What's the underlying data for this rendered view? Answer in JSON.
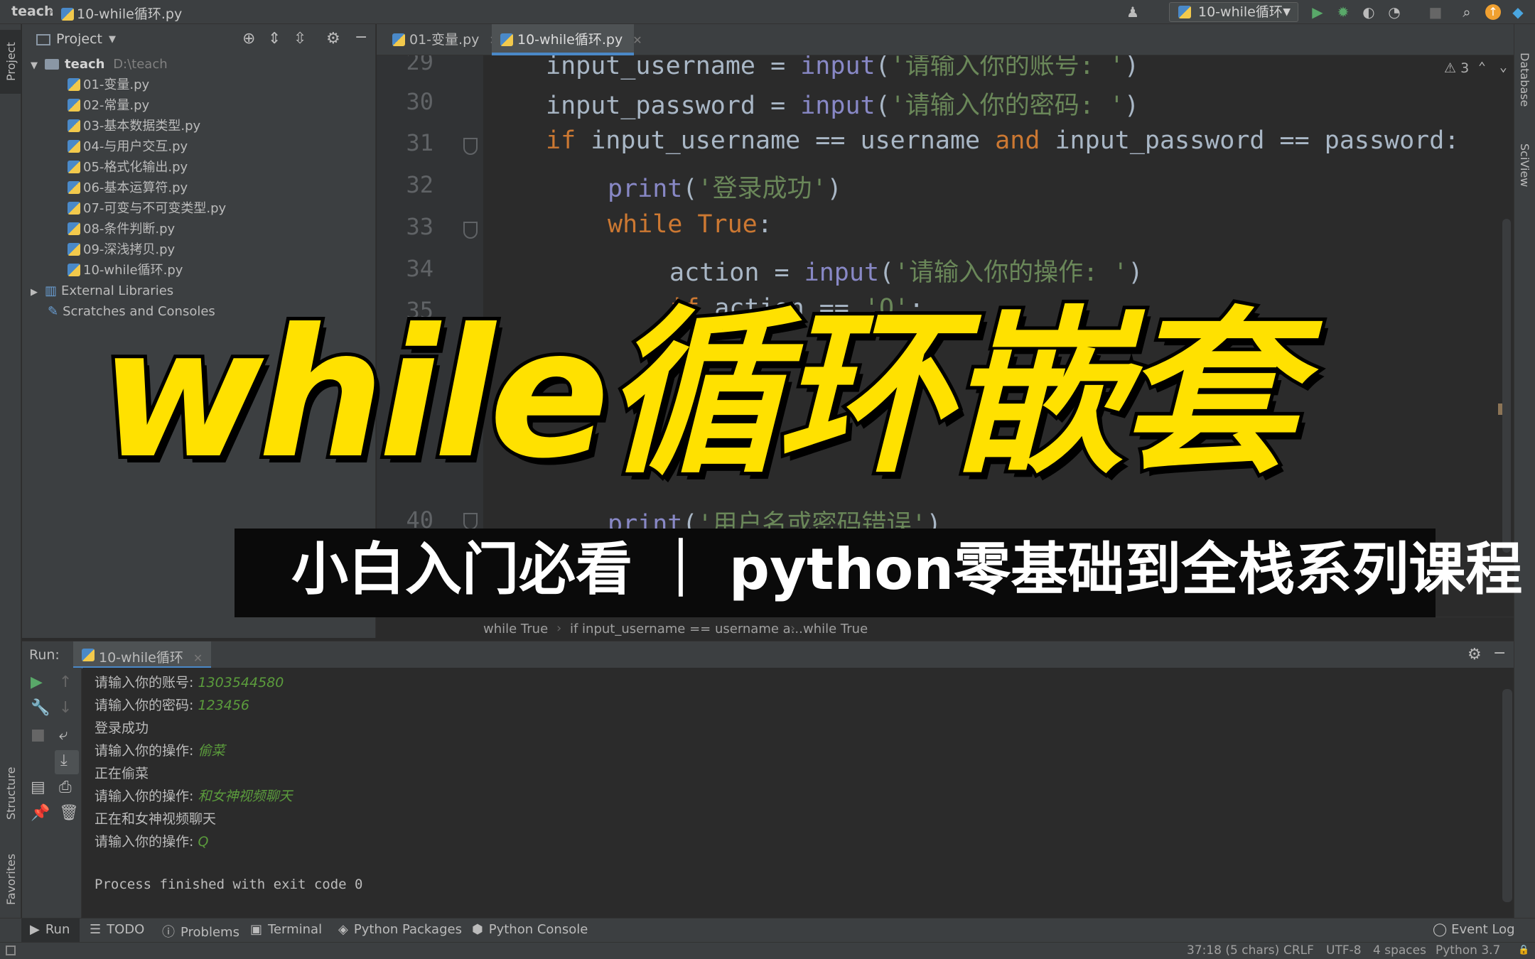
{
  "navbar": {
    "project_crumb": "teach",
    "file_crumb": "10-while循环.py",
    "run_config": "10-while循环"
  },
  "left_stripe": {
    "project_label": "Project",
    "structure_label": "Structure",
    "favorites_label": "Favorites"
  },
  "right_stripe": {
    "database_label": "Database",
    "sciview_label": "SciView"
  },
  "project_panel": {
    "title": "Project",
    "root_name": "teach",
    "root_path": "D:\\teach",
    "files": [
      "01-变量.py",
      "02-常量.py",
      "03-基本数据类型.py",
      "04-与用户交互.py",
      "05-格式化输出.py",
      "06-基本运算符.py",
      "07-可变与不可变类型.py",
      "08-条件判断.py",
      "09-深浅拷贝.py",
      "10-while循环.py"
    ],
    "external_libraries": "External Libraries",
    "scratches": "Scratches and Consoles"
  },
  "tabs": [
    {
      "label": "01-变量.py",
      "active": false
    },
    {
      "label": "10-while循环.py",
      "active": true
    }
  ],
  "editor": {
    "warning_count": "3",
    "line_numbers": [
      "29",
      "30",
      "31",
      "32",
      "33",
      "34",
      "35",
      "40"
    ],
    "lines": [
      {
        "a": "input_username = ",
        "b": "input",
        "c": "(",
        "d": "'请输入你的账号: '",
        "e": ")"
      },
      {
        "a": "input_password = ",
        "b": "input",
        "c": "(",
        "d": "'请输入你的密码: '",
        "e": ")"
      },
      {
        "kw1": "if",
        "a": " input_username == username ",
        "kw2": "and",
        "b": " input_password == password:"
      },
      {
        "b": "print",
        "c": "(",
        "d": "'登录成功'",
        "e": ")"
      },
      {
        "kw1": "while",
        "kw2": " True",
        "a": ":"
      },
      {
        "a": "action = ",
        "b": "input",
        "c": "(",
        "d": "'请输入你的操作: '",
        "e": ")"
      },
      {
        "kw1": "if",
        "a": " action == ",
        "d": "'Q'",
        "e": ":"
      },
      {
        "b": "print",
        "c": "(",
        "d": "'用户名或密码错误'",
        "e": ")"
      }
    ]
  },
  "breadcrumb": [
    "while True",
    "if input_username == username a...",
    "while True"
  ],
  "run_panel": {
    "label": "Run:",
    "tab": "10-while循环",
    "console": [
      {
        "prompt": "请输入你的账号: ",
        "input": "1303544580"
      },
      {
        "prompt": "请输入你的密码: ",
        "input": "123456"
      },
      {
        "prompt": "登录成功",
        "input": ""
      },
      {
        "prompt": "请输入你的操作: ",
        "input": "偷菜"
      },
      {
        "prompt": "正在偷菜",
        "input": ""
      },
      {
        "prompt": "请输入你的操作: ",
        "input": "和女神视频聊天"
      },
      {
        "prompt": "正在和女神视频聊天",
        "input": ""
      },
      {
        "prompt": "请输入你的操作: ",
        "input": "Q"
      },
      {
        "prompt": "",
        "input": ""
      },
      {
        "prompt": "Process finished with exit code 0",
        "input": ""
      }
    ]
  },
  "bottom_tools": [
    "Run",
    "TODO",
    "Problems",
    "Terminal",
    "Python Packages",
    "Python Console"
  ],
  "event_log": "Event Log",
  "status": {
    "position": "37:18 (5 chars)",
    "line_sep": "CRLF",
    "encoding": "UTF-8",
    "indent": "4 spaces",
    "interpreter": "Python 3.7"
  },
  "overlay": {
    "title": "while循环嵌套",
    "subtitle": "小白入门必看 ｜ python零基础到全栈系列课程"
  },
  "colors": {
    "accent": "#4a88c7",
    "title_yellow": "#ffe100",
    "keyword": "#cc7832",
    "string": "#6a8759",
    "builtin": "#8888c6",
    "console_input": "#5b9c3c"
  }
}
